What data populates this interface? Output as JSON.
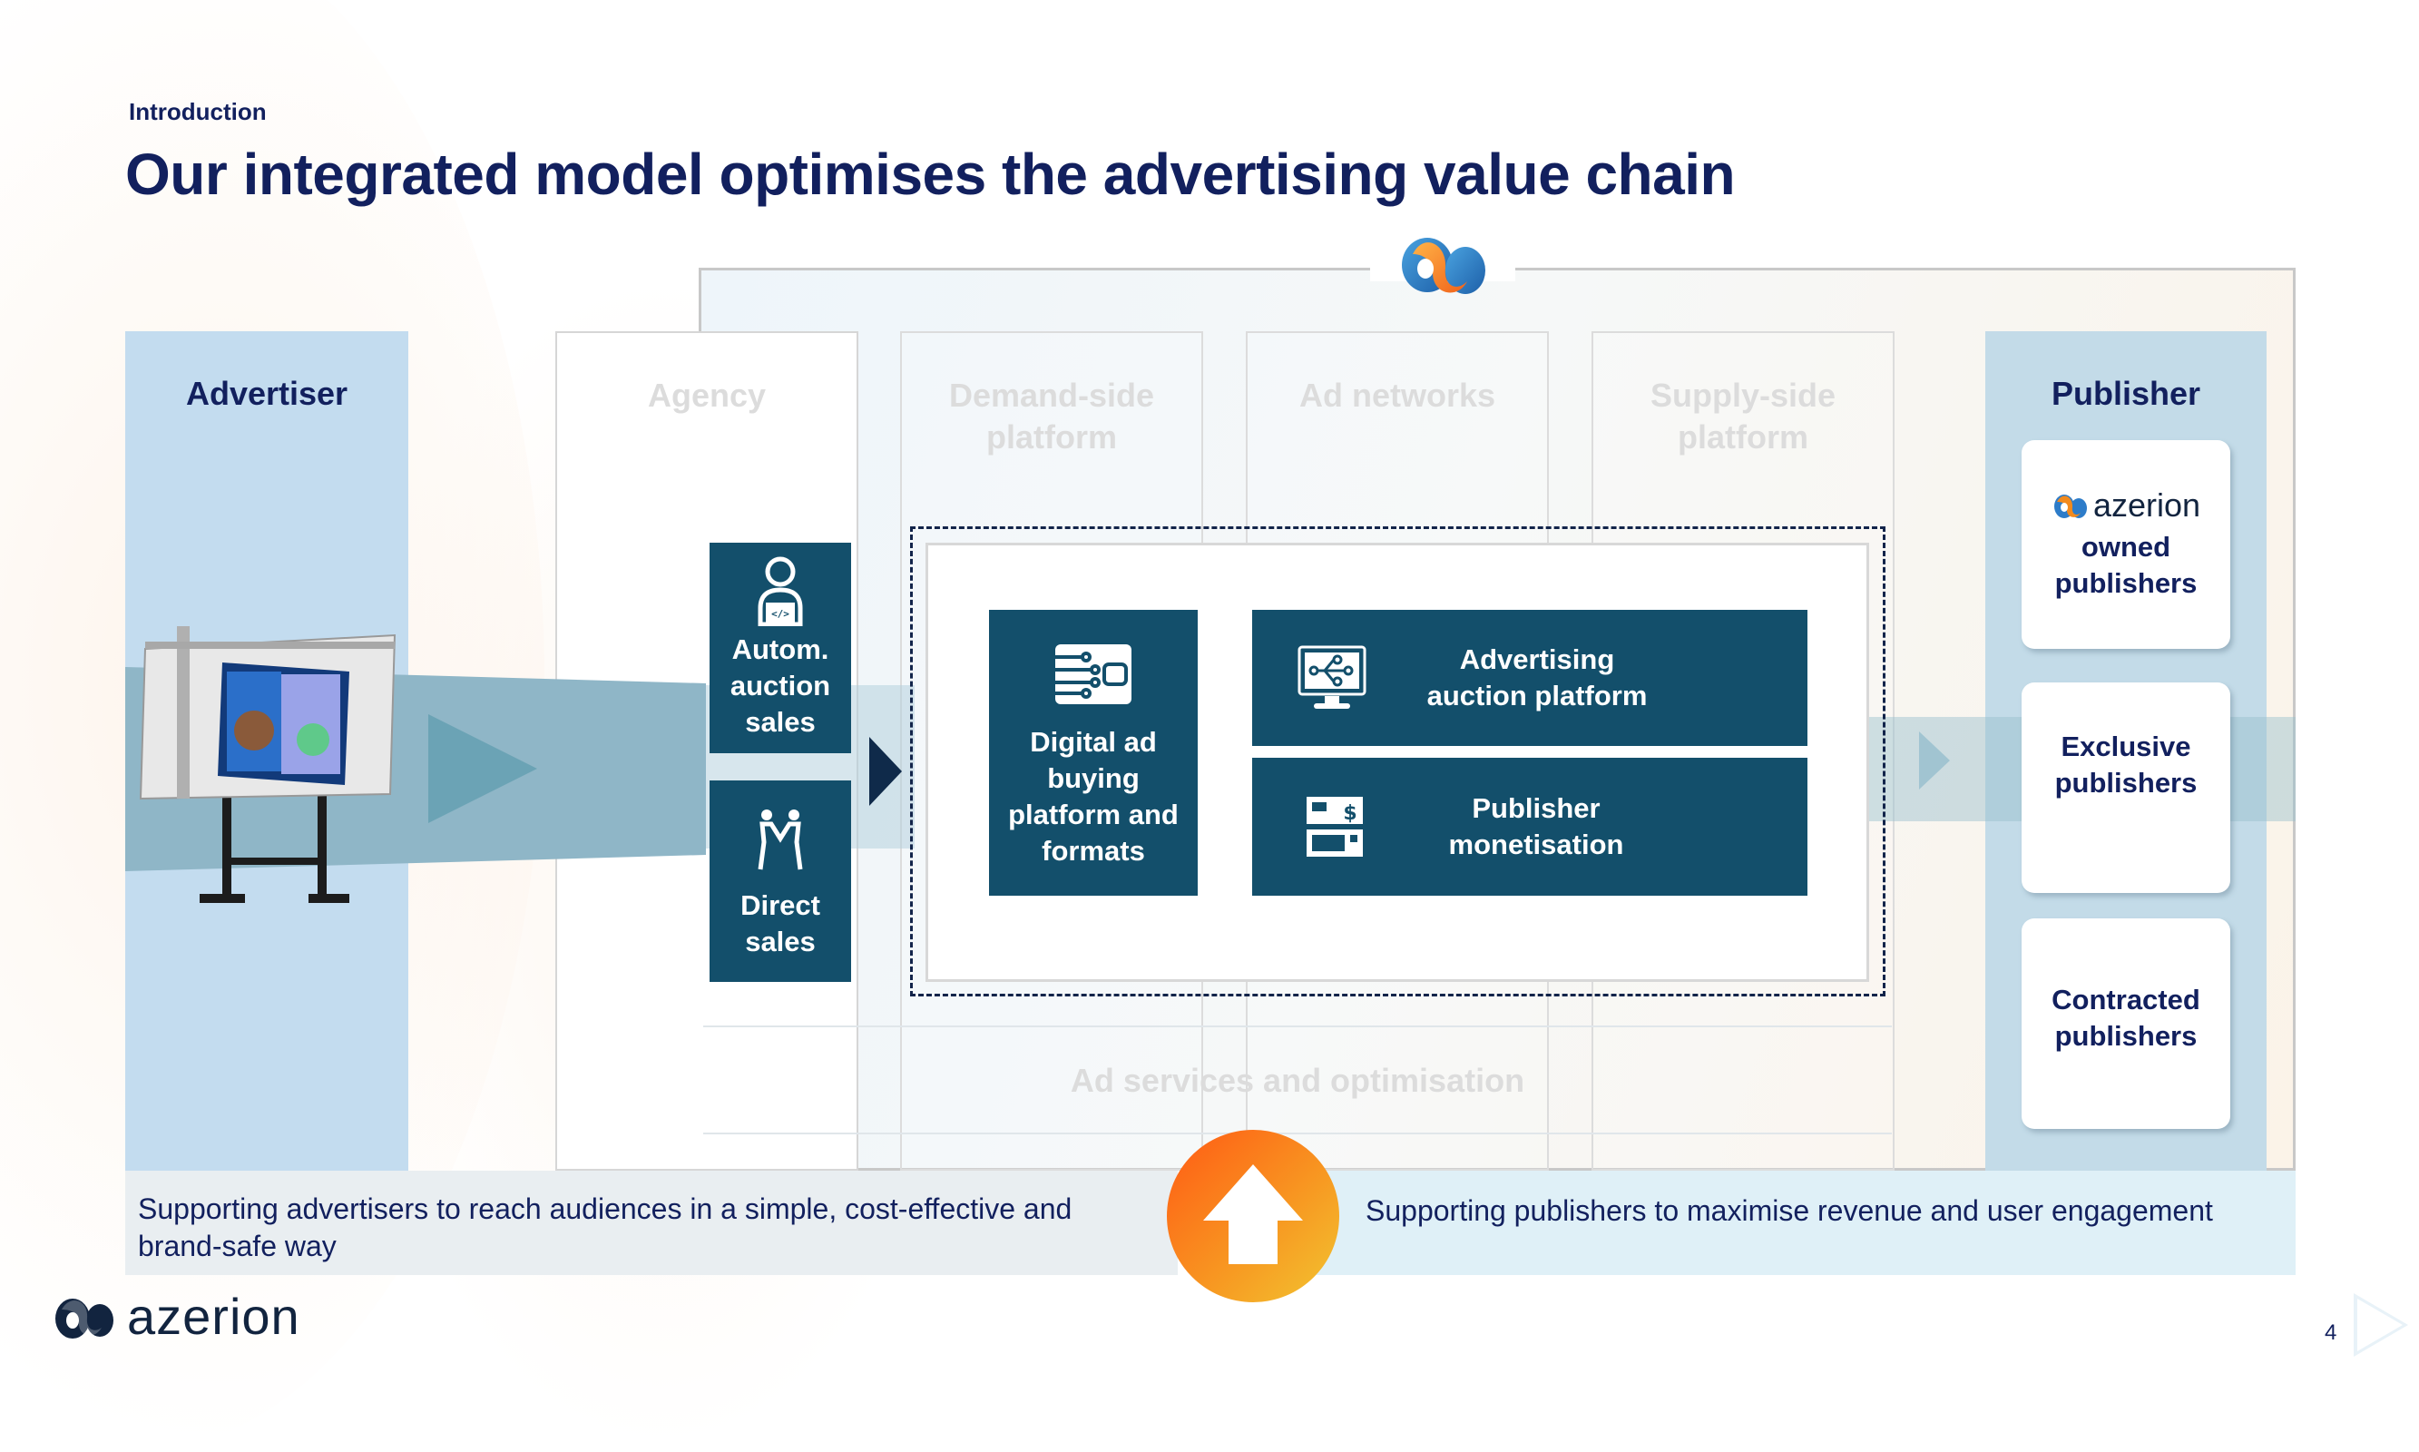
{
  "slide": {
    "kicker": "Introduction",
    "title": "Our integrated model optimises the advertising value chain",
    "page_number": "4"
  },
  "columns": {
    "advertiser": "Advertiser",
    "agency": "Agency",
    "dsp": [
      "Demand-side",
      "platform"
    ],
    "ad_networks": "Ad networks",
    "ssp": [
      "Supply-side",
      "platform"
    ],
    "publisher": "Publisher",
    "ad_services": "Ad services and optimisation"
  },
  "sales": {
    "autom": [
      "Autom.",
      "auction",
      "sales"
    ],
    "direct": [
      "Direct",
      "sales"
    ]
  },
  "platform": {
    "digital": [
      "Digital ad",
      "buying",
      "platform and",
      "formats"
    ],
    "auction": [
      "Advertising",
      "auction platform"
    ],
    "monetisation": [
      "Publisher",
      "monetisation"
    ]
  },
  "publishers": {
    "owned_brand": "azerion",
    "owned": [
      "owned",
      "publishers"
    ],
    "exclusive": [
      "Exclusive",
      "publishers"
    ],
    "contracted": [
      "Contracted",
      "publishers"
    ]
  },
  "bottom": {
    "left": "Supporting advertisers to reach audiences in a simple, cost-effective and brand-safe way",
    "right": "Supporting publishers to maximise revenue and user engagement"
  },
  "footer": {
    "brand": "azerion"
  },
  "icons": {
    "autom": "developer-laptop-icon",
    "direct": "handshake-people-icon",
    "digital": "circuit-chip-icon",
    "auction": "monitor-network-icon",
    "monetisation": "payment-terminal-icon",
    "up": "arrow-up-icon"
  },
  "colors": {
    "navy": "#12205e",
    "teal_box": "#134f6b",
    "advertiser_bg": "#c3dcef",
    "publisher_bg": "#c3dbe8",
    "orange": "#f79a22"
  }
}
